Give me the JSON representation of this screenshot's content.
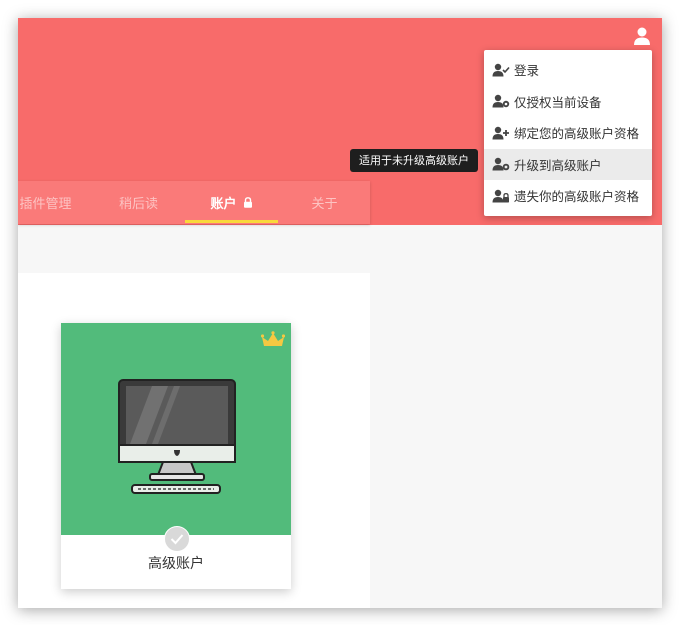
{
  "tabs": [
    {
      "label": "插件管理"
    },
    {
      "label": "稍后读"
    },
    {
      "label": "账户"
    },
    {
      "label": "关于"
    }
  ],
  "tooltip": {
    "text": "适用于未升级高级账户"
  },
  "user_menu": {
    "items": [
      {
        "label": "登录",
        "icon": "user-check-icon"
      },
      {
        "label": "仅授权当前设备",
        "icon": "user-device-icon"
      },
      {
        "label": "绑定您的高级账户资格",
        "icon": "user-add-icon"
      },
      {
        "label": "升级到高级账户",
        "icon": "user-upgrade-icon"
      },
      {
        "label": "遗失你的高级账户资格",
        "icon": "user-lock-icon"
      }
    ]
  },
  "plan_card": {
    "title": "高级账户",
    "badge_icon": "crown-icon",
    "image_icon": "imac-icon"
  },
  "colors": {
    "header": "#f86b6a",
    "tab_indicator": "#f9d83b",
    "card_top": "#52bb7b",
    "crown": "#f5c842"
  }
}
